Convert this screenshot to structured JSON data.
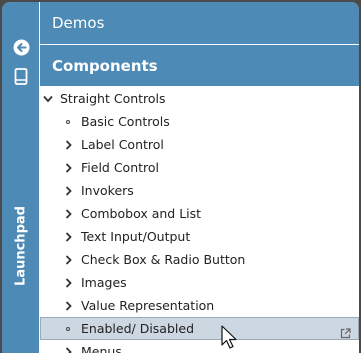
{
  "rail": {
    "back_icon": "arrow-left-circle-icon",
    "device_icon": "tablet-icon",
    "label": "Launchpad"
  },
  "header": {
    "title": "Demos",
    "section": "Components"
  },
  "tree": {
    "group": {
      "label": "Straight Controls",
      "expanded": true
    },
    "items": [
      {
        "label": "Basic Controls",
        "kind": "leaf"
      },
      {
        "label": "Label Control",
        "kind": "branch"
      },
      {
        "label": "Field Control",
        "kind": "branch"
      },
      {
        "label": "Invokers",
        "kind": "branch"
      },
      {
        "label": "Combobox and List",
        "kind": "branch"
      },
      {
        "label": "Text Input/Output",
        "kind": "branch"
      },
      {
        "label": "Check Box & Radio Button",
        "kind": "branch"
      },
      {
        "label": "Images",
        "kind": "branch"
      },
      {
        "label": "Value Representation",
        "kind": "branch"
      },
      {
        "label": "Enabled/ Disabled",
        "kind": "leaf",
        "selected": true,
        "icon": "external-link-icon"
      },
      {
        "label": "Menus",
        "kind": "branch"
      }
    ]
  },
  "colors": {
    "accent": "#4d8ab5",
    "selected": "#cdd7e1"
  }
}
